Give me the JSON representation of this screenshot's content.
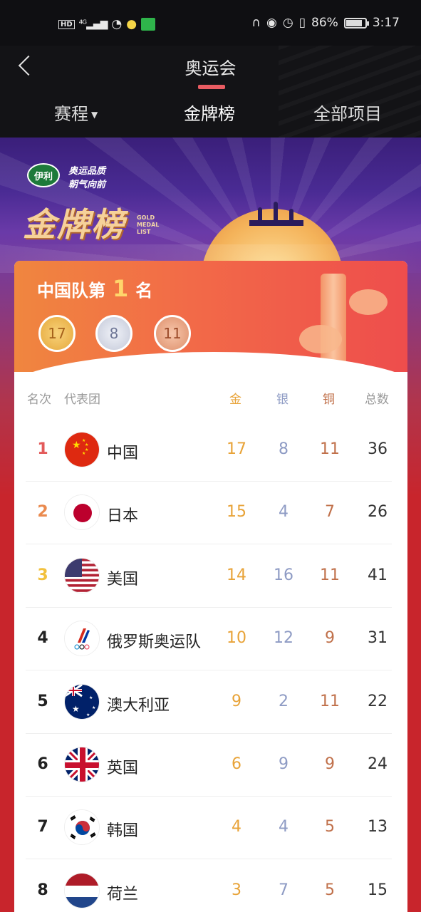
{
  "status": {
    "left": [
      "HD",
      "4G",
      "wifi-icon",
      "bulb-icon",
      "app-icon"
    ],
    "battery": "86%",
    "battery_level": 0.86,
    "time": "3:17"
  },
  "nav": {
    "title": "奥运会",
    "tabs": [
      {
        "label": "赛程",
        "has_caret": true
      },
      {
        "label": "金牌榜",
        "active": true
      },
      {
        "label": "全部项目"
      }
    ]
  },
  "banner": {
    "brand": "伊利",
    "slogan_line1": "奥运品质",
    "slogan_line2": "朝气向前",
    "title": "金牌榜",
    "subtitle_lines": [
      "GOLD",
      "MEDAL",
      "LIST"
    ]
  },
  "summary": {
    "prefix": "中国队第",
    "rank": "1",
    "suffix": "名",
    "gold": "17",
    "silver": "8",
    "bronze": "11"
  },
  "table": {
    "headers": {
      "rank": "名次",
      "team": "代表团",
      "gold": "金",
      "silver": "银",
      "bronze": "铜",
      "total": "总数"
    },
    "rows": [
      {
        "rank": "1",
        "team": "中国",
        "gold": "17",
        "silver": "8",
        "bronze": "11",
        "total": "36",
        "rank_color": "#e35a5a",
        "flag": "china"
      },
      {
        "rank": "2",
        "team": "日本",
        "gold": "15",
        "silver": "4",
        "bronze": "7",
        "total": "26",
        "rank_color": "#ea8a4e",
        "flag": "japan"
      },
      {
        "rank": "3",
        "team": "美国",
        "gold": "14",
        "silver": "16",
        "bronze": "11",
        "total": "41",
        "rank_color": "#f2c13e",
        "flag": "usa"
      },
      {
        "rank": "4",
        "team": "俄罗斯奥运队",
        "gold": "10",
        "silver": "12",
        "bronze": "9",
        "total": "31",
        "flag": "roc"
      },
      {
        "rank": "5",
        "team": "澳大利亚",
        "gold": "9",
        "silver": "2",
        "bronze": "11",
        "total": "22",
        "flag": "australia"
      },
      {
        "rank": "6",
        "team": "英国",
        "gold": "6",
        "silver": "9",
        "bronze": "9",
        "total": "24",
        "flag": "uk"
      },
      {
        "rank": "7",
        "team": "韩国",
        "gold": "4",
        "silver": "4",
        "bronze": "5",
        "total": "13",
        "flag": "korea"
      },
      {
        "rank": "8",
        "team": "荷兰",
        "gold": "3",
        "silver": "7",
        "bronze": "5",
        "total": "15",
        "flag": "netherlands"
      }
    ]
  },
  "colors": {
    "gold": "#e8a338",
    "silver": "#8e9bc4",
    "bronze": "#c0704a",
    "accent": "#e95c62"
  }
}
